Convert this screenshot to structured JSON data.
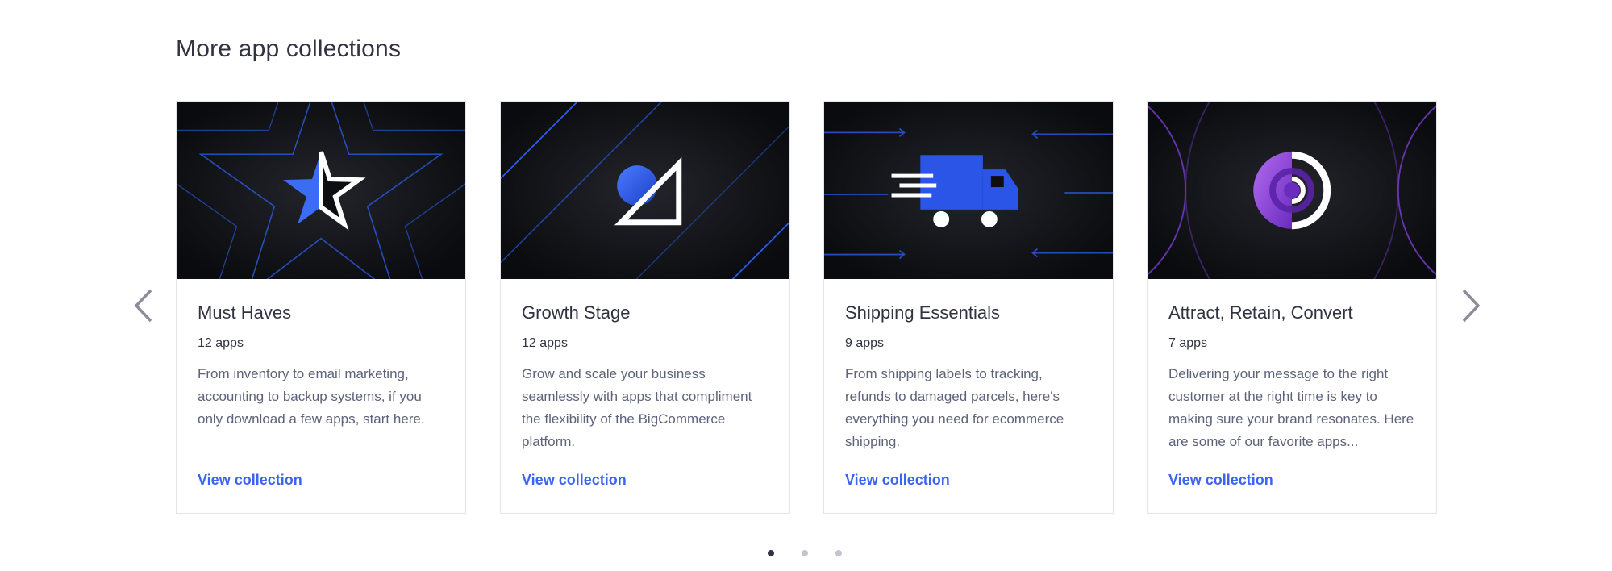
{
  "section": {
    "title": "More app collections"
  },
  "nav": {
    "prev_icon": "chevron-left-icon",
    "next_icon": "chevron-right-icon"
  },
  "collections": [
    {
      "title": "Must Haves",
      "count": "12 apps",
      "description": "From inventory to email marketing, accounting to backup systems, if you only download a few apps, start here.",
      "link": "View collection",
      "icon": "star-icon"
    },
    {
      "title": "Growth Stage",
      "count": "12 apps",
      "description": "Grow and scale your business seamlessly with apps that compliment the flexibility of the BigCommerce platform.",
      "link": "View collection",
      "icon": "circle-triangle-icon"
    },
    {
      "title": "Shipping Essentials",
      "count": "9 apps",
      "description": "From shipping labels to tracking, refunds to damaged parcels, here's everything you need for ecommerce shipping.",
      "link": "View collection",
      "icon": "truck-icon"
    },
    {
      "title": "Attract, Retain, Convert",
      "count": "7 apps",
      "description": "Delivering your message to the right customer at the right time is key to making sure your brand resonates. Here are some of our favorite apps...",
      "link": "View collection",
      "icon": "target-icon"
    }
  ],
  "pagination": {
    "pages": 3,
    "current": 1
  },
  "colors": {
    "accent": "#3c64f4",
    "hero_bg": "#0d0e12",
    "hero_line_blue": "#2d5be3",
    "hero_line_purple": "#7b3fd1"
  }
}
